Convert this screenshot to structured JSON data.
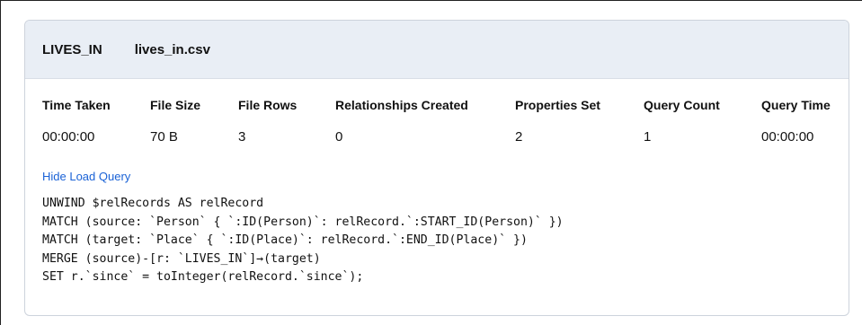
{
  "header": {
    "rel_type": "LIVES_IN",
    "file_name": "lives_in.csv"
  },
  "stats": [
    {
      "label": "Time Taken",
      "value": "00:00:00"
    },
    {
      "label": "File Size",
      "value": "70 B"
    },
    {
      "label": "File Rows",
      "value": "3"
    },
    {
      "label": "Relationships Created",
      "value": "0"
    },
    {
      "label": "Properties Set",
      "value": "2"
    },
    {
      "label": "Query Count",
      "value": "1"
    },
    {
      "label": "Query Time",
      "value": "00:00:00"
    }
  ],
  "toggle_label": "Hide Load Query",
  "query_lines": [
    "UNWIND $relRecords AS relRecord",
    "MATCH (source: `Person` { `:ID(Person)`: relRecord.`:START_ID(Person)` })",
    "MATCH (target: `Place` { `:ID(Place)`: relRecord.`:END_ID(Place)` })",
    "MERGE (source)-[r: `LIVES_IN`]→(target)",
    "SET r.`since` = toInteger(relRecord.`since`);"
  ]
}
